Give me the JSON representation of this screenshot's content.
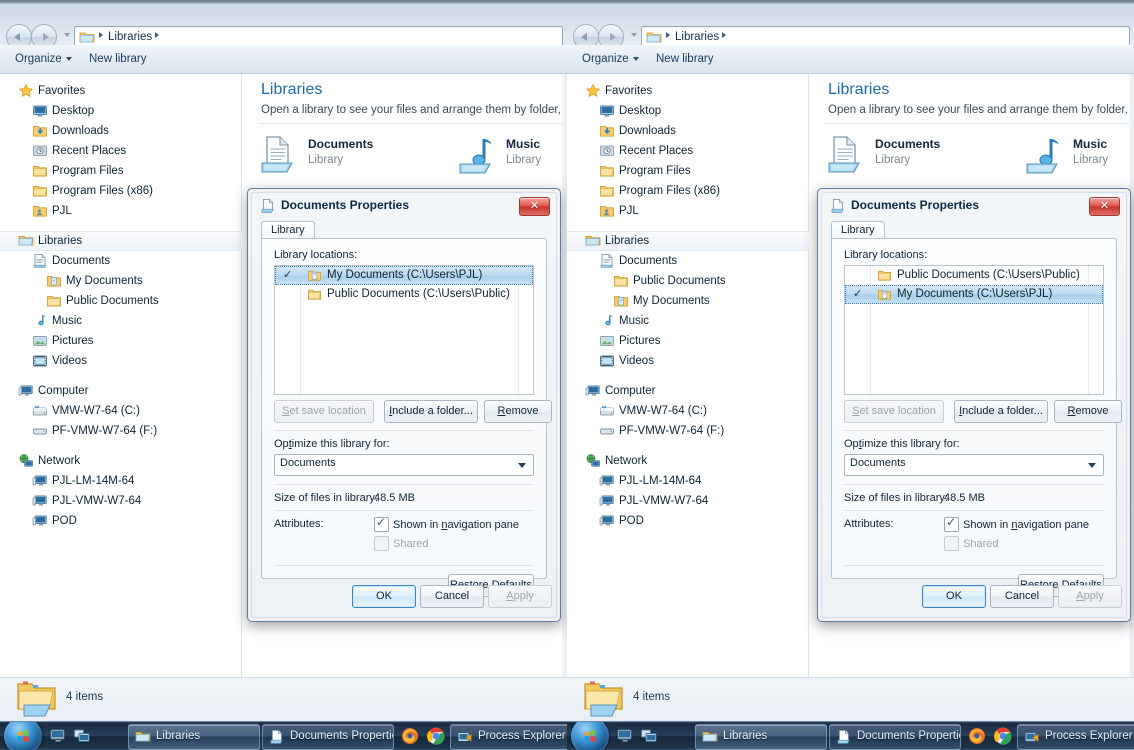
{
  "window": {
    "address": {
      "breadcrumb": [
        "Libraries"
      ],
      "folder_icon": "libraries-folder-icon"
    },
    "toolbar": {
      "organize": "Organize",
      "new_library": "New library"
    },
    "status": {
      "item_count": "4 items"
    }
  },
  "nav_pane": {
    "groups": [
      {
        "header": {
          "label": "Favorites",
          "icon": "star-icon"
        },
        "items": [
          {
            "label": "Desktop",
            "icon": "desktop-icon"
          },
          {
            "label": "Downloads",
            "icon": "downloads-folder-icon"
          },
          {
            "label": "Recent Places",
            "icon": "recent-places-icon"
          },
          {
            "label": "Program Files",
            "icon": "folder-icon"
          },
          {
            "label": "Program Files (x86)",
            "icon": "folder-icon"
          },
          {
            "label": "PJL",
            "icon": "user-folder-icon"
          }
        ]
      },
      {
        "header": {
          "label": "Libraries",
          "icon": "libraries-icon",
          "selected": true
        },
        "items_left": [
          {
            "label": "Documents",
            "icon": "documents-library-icon",
            "indent": 1
          },
          {
            "label": "My Documents",
            "icon": "my-documents-folder-icon",
            "indent": 2
          },
          {
            "label": "Public Documents",
            "icon": "public-documents-folder-icon",
            "indent": 2
          },
          {
            "label": "Music",
            "icon": "music-library-icon",
            "indent": 1
          },
          {
            "label": "Pictures",
            "icon": "pictures-library-icon",
            "indent": 1
          },
          {
            "label": "Videos",
            "icon": "videos-library-icon",
            "indent": 1
          }
        ],
        "items_right": [
          {
            "label": "Documents",
            "icon": "documents-library-icon",
            "indent": 1
          },
          {
            "label": "Public Documents",
            "icon": "public-documents-folder-icon",
            "indent": 2
          },
          {
            "label": "My Documents",
            "icon": "my-documents-folder-icon",
            "indent": 2
          },
          {
            "label": "Music",
            "icon": "music-library-icon",
            "indent": 1
          },
          {
            "label": "Pictures",
            "icon": "pictures-library-icon",
            "indent": 1
          },
          {
            "label": "Videos",
            "icon": "videos-library-icon",
            "indent": 1
          }
        ]
      },
      {
        "header": {
          "label": "Computer",
          "icon": "computer-icon"
        },
        "items": [
          {
            "label": "VMW-W7-64 (C:)",
            "icon": "system-drive-icon"
          },
          {
            "label": "PF-VMW-W7-64 (F:)",
            "icon": "removable-drive-icon"
          }
        ]
      },
      {
        "header": {
          "label": "Network",
          "icon": "network-icon"
        },
        "items": [
          {
            "label": "PJL-LM-14M-64",
            "icon": "network-computer-icon"
          },
          {
            "label": "PJL-VMW-W7-64",
            "icon": "network-computer-icon"
          },
          {
            "label": "POD",
            "icon": "network-computer-icon"
          }
        ]
      }
    ]
  },
  "content": {
    "title": "Libraries",
    "subtitle": "Open a library to see your files and arrange them by folder, date, and o",
    "libraries": [
      {
        "name": "Documents",
        "type": "Library",
        "icon": "documents-library-icon"
      },
      {
        "name": "Music",
        "type": "Library",
        "icon": "music-library-icon"
      }
    ]
  },
  "dialog": {
    "title": "Documents Properties",
    "title_icon": "documents-library-icon",
    "close_label": "✕",
    "tab": "Library",
    "locations_label": "Library locations:",
    "locations_left": [
      {
        "label": "My Documents (C:\\Users\\PJL)",
        "checked": true,
        "selected": true,
        "icon": "my-documents-folder-icon"
      },
      {
        "label": "Public Documents (C:\\Users\\Public)",
        "checked": false,
        "selected": false,
        "icon": "public-documents-folder-icon"
      }
    ],
    "locations_right": [
      {
        "label": "Public Documents (C:\\Users\\Public)",
        "checked": false,
        "selected": false,
        "icon": "public-documents-folder-icon"
      },
      {
        "label": "My Documents (C:\\Users\\PJL)",
        "checked": true,
        "selected": true,
        "icon": "my-documents-folder-icon"
      }
    ],
    "buttons": {
      "set_save_location": "Set save location",
      "include_folder": "Include a folder...",
      "remove": "Remove",
      "restore_defaults": "Restore Defaults",
      "ok": "OK",
      "cancel": "Cancel",
      "apply": "Apply"
    },
    "optimize_label": "Optimize this library for:",
    "optimize_value": "Documents",
    "size_label": "Size of files in library:",
    "size_value": "48.5 MB",
    "attributes_label": "Attributes:",
    "attr_shown": {
      "label": "Shown in navigation pane",
      "checked": true,
      "enabled": true
    },
    "attr_shared": {
      "label": "Shared",
      "checked": false,
      "enabled": false
    }
  },
  "taskbar": {
    "start_label": "Start",
    "quick_launch": [
      {
        "icon": "show-desktop-icon"
      },
      {
        "icon": "switch-window-icon"
      }
    ],
    "buttons": [
      {
        "label": "Libraries",
        "icon": "libraries-folder-icon",
        "active": true
      },
      {
        "label": "Documents Properties",
        "icon": "documents-library-icon",
        "active": false
      },
      {
        "label": "Process Explorer",
        "icon": "process-explorer-icon",
        "active": false
      }
    ],
    "tray_icons": [
      {
        "icon": "firefox-icon"
      },
      {
        "icon": "chrome-icon"
      }
    ]
  },
  "colors": {
    "accent": "#1d6ba8",
    "selection": "#bcd9ef",
    "taskbar": "#1b2c41",
    "close_button": "#c8322a"
  }
}
